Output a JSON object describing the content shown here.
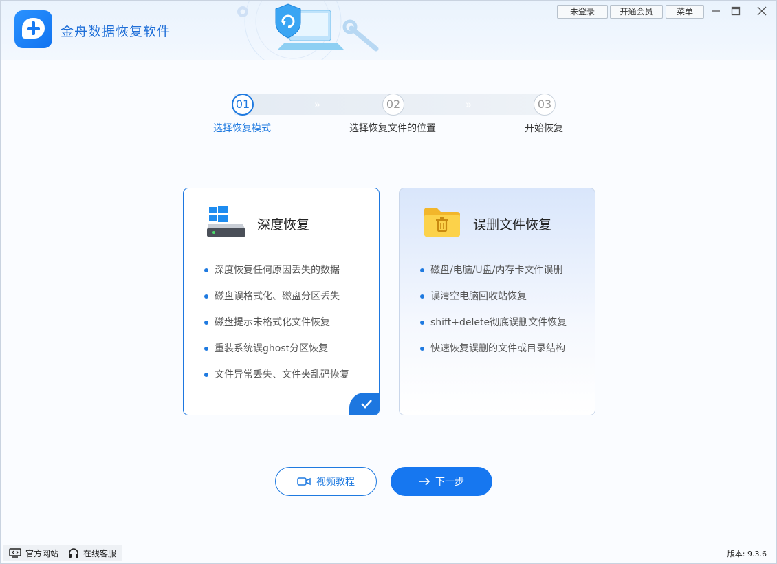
{
  "app": {
    "title": "金舟数据恢复软件"
  },
  "topbar": {
    "login_label": "未登录",
    "vip_label": "开通会员",
    "menu_label": "菜单"
  },
  "steps": [
    {
      "number": "01",
      "label": "选择恢复模式",
      "active": true
    },
    {
      "number": "02",
      "label": "选择恢复文件的位置",
      "active": false
    },
    {
      "number": "03",
      "label": "开始恢复",
      "active": false
    }
  ],
  "step_separator": "»",
  "cards": [
    {
      "title": "深度恢复",
      "selected": true,
      "icon": "hard-drive-windows-icon",
      "features": [
        "深度恢复任何原因丢失的数据",
        "磁盘误格式化、磁盘分区丢失",
        "磁盘提示未格式化文件恢复",
        "重装系统误ghost分区恢复",
        "文件异常丢失、文件夹乱码恢复"
      ]
    },
    {
      "title": "误删文件恢复",
      "selected": false,
      "icon": "folder-trash-icon",
      "features": [
        "磁盘/电脑/U盘/内存卡文件误删",
        "误清空电脑回收站恢复",
        "shift+delete彻底误删文件恢复",
        "快速恢复误删的文件或目录结构"
      ]
    }
  ],
  "actions": {
    "video_label": "视频教程",
    "next_label": "下一步"
  },
  "footer": {
    "website_label": "官方网站",
    "support_label": "在线客服",
    "version_text": "版本: 9.3.6"
  },
  "colors": {
    "accent": "#1f7ae0",
    "primary_button": "#1677f0"
  }
}
